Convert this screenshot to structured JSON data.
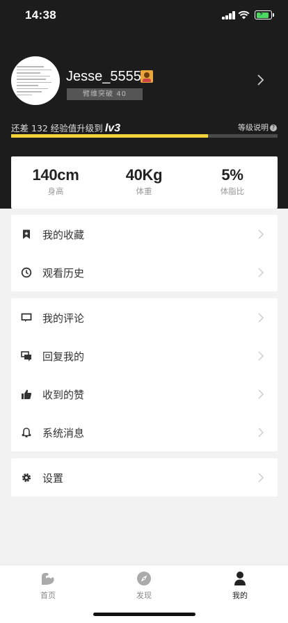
{
  "status_bar": {
    "time": "14:38"
  },
  "profile": {
    "username": "Jesse_5555",
    "level_tag": "臂维突破 40",
    "progress_prefix": "还差 132 经验值升级到",
    "progress_level": "lv3",
    "progress_fraction": 0.74,
    "level_help": "等级说明",
    "help_symbol": "?"
  },
  "stats": [
    {
      "value": "140cm",
      "label": "身高"
    },
    {
      "value": "40Kg",
      "label": "体重"
    },
    {
      "value": "5%",
      "label": "体脂比"
    }
  ],
  "menu_groups": [
    {
      "items": [
        {
          "label": "我的收藏",
          "icon": "bookmark-icon"
        },
        {
          "label": "观看历史",
          "icon": "clock-icon"
        }
      ]
    },
    {
      "items": [
        {
          "label": "我的评论",
          "icon": "comment-icon"
        },
        {
          "label": "回复我的",
          "icon": "reply-icon"
        },
        {
          "label": "收到的赞",
          "icon": "thumbs-up-icon"
        },
        {
          "label": "系统消息",
          "icon": "bell-icon"
        }
      ]
    },
    {
      "items": [
        {
          "label": "设置",
          "icon": "gear-icon"
        }
      ]
    }
  ],
  "tabbar": {
    "tabs": [
      {
        "label": "首页",
        "icon": "flex-arm-icon",
        "active": false
      },
      {
        "label": "发现",
        "icon": "compass-icon",
        "active": false
      },
      {
        "label": "我的",
        "icon": "person-icon",
        "active": true
      }
    ]
  },
  "colors": {
    "header_bg": "#1c1c1c",
    "accent": "#f4d23a",
    "page_bg": "#f2f2f2",
    "battery": "#4cd964"
  }
}
